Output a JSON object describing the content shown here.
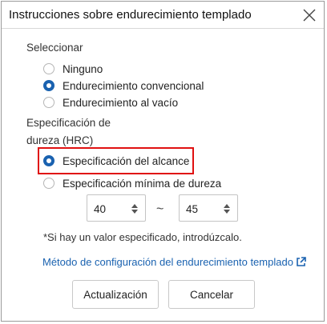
{
  "dialog": {
    "title": "Instrucciones sobre endurecimiento templado"
  },
  "select_section": {
    "label": "Seleccionar",
    "options": [
      {
        "label": "Ninguno",
        "checked": false
      },
      {
        "label": "Endurecimiento convencional",
        "checked": true
      },
      {
        "label": "Endurecimiento al vacío",
        "checked": false
      }
    ]
  },
  "hardness_section": {
    "label_line1": "Especificación de",
    "label_line2": "dureza (HRC)",
    "options": [
      {
        "label": "Especificación del alcance",
        "checked": true
      },
      {
        "label": "Especificación mínima de dureza",
        "checked": false
      }
    ],
    "range_min": "40",
    "range_separator": "~",
    "range_max": "45"
  },
  "note": "*Si hay un valor especificado, introdúzcalo.",
  "help_link": "Método de configuración del endurecimiento templado",
  "buttons": {
    "update": "Actualización",
    "cancel": "Cancelar"
  },
  "colors": {
    "accent": "#1a62b0",
    "highlight": "#e01010"
  }
}
